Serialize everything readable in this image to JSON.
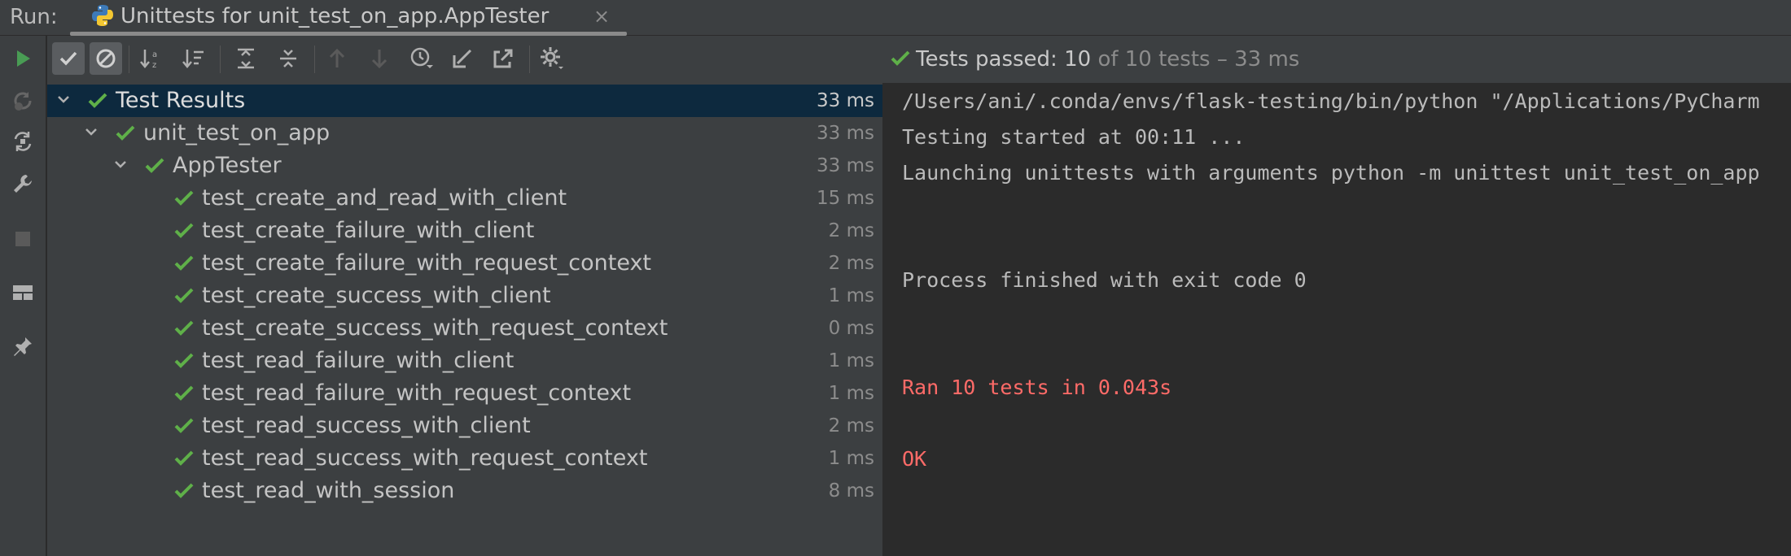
{
  "window": {
    "run_label": "Run:",
    "tab_title": "Unittests for unit_test_on_app.AppTester",
    "tab_close": "×"
  },
  "colors": {
    "pass_green": "#5fb049",
    "run_green": "#499c54",
    "error_red": "#ff6b68",
    "selection": "#0d293e"
  },
  "left_strip_icons": [
    "run-icon",
    "rerun-failed-icon",
    "toggle-auto-test-icon",
    "wrench-icon",
    "stop-icon",
    "layout-icon",
    "pin-icon"
  ],
  "toolbar_icons": [
    "show-passed-icon",
    "show-ignored-icon",
    "sort-alphabetically-icon",
    "sort-by-duration-icon",
    "expand-all-icon",
    "collapse-all-icon",
    "previous-failed-icon",
    "next-failed-icon",
    "test-history-icon",
    "import-tests-icon",
    "export-tests-icon",
    "settings-icon"
  ],
  "status": {
    "label": "Tests passed:",
    "passed": "10",
    "rest": "of 10 tests – 33 ms"
  },
  "tree": {
    "root": {
      "label": "Test Results",
      "time": "33 ms"
    },
    "module": {
      "label": "unit_test_on_app",
      "time": "33 ms"
    },
    "class": {
      "label": "AppTester",
      "time": "33 ms"
    },
    "tests": [
      {
        "name": "test_create_and_read_with_client",
        "time": "15 ms"
      },
      {
        "name": "test_create_failure_with_client",
        "time": "2 ms"
      },
      {
        "name": "test_create_failure_with_request_context",
        "time": "2 ms"
      },
      {
        "name": "test_create_success_with_client",
        "time": "1 ms"
      },
      {
        "name": "test_create_success_with_request_context",
        "time": "0 ms"
      },
      {
        "name": "test_read_failure_with_client",
        "time": "1 ms"
      },
      {
        "name": "test_read_failure_with_request_context",
        "time": "1 ms"
      },
      {
        "name": "test_read_success_with_client",
        "time": "2 ms"
      },
      {
        "name": "test_read_success_with_request_context",
        "time": "1 ms"
      },
      {
        "name": "test_read_with_session",
        "time": "8 ms"
      }
    ]
  },
  "console": {
    "lines": [
      {
        "text": "/Users/ani/.conda/envs/flask-testing/bin/python \"/Applications/PyCharm",
        "kind": "normal"
      },
      {
        "text": "Testing started at 00:11 ...",
        "kind": "normal"
      },
      {
        "text": "Launching unittests with arguments python -m unittest unit_test_on_app",
        "kind": "normal"
      },
      {
        "text": "Process finished with exit code 0",
        "kind": "normal"
      },
      {
        "text": "Ran 10 tests in 0.043s",
        "kind": "error"
      },
      {
        "text": "OK",
        "kind": "error"
      }
    ]
  }
}
